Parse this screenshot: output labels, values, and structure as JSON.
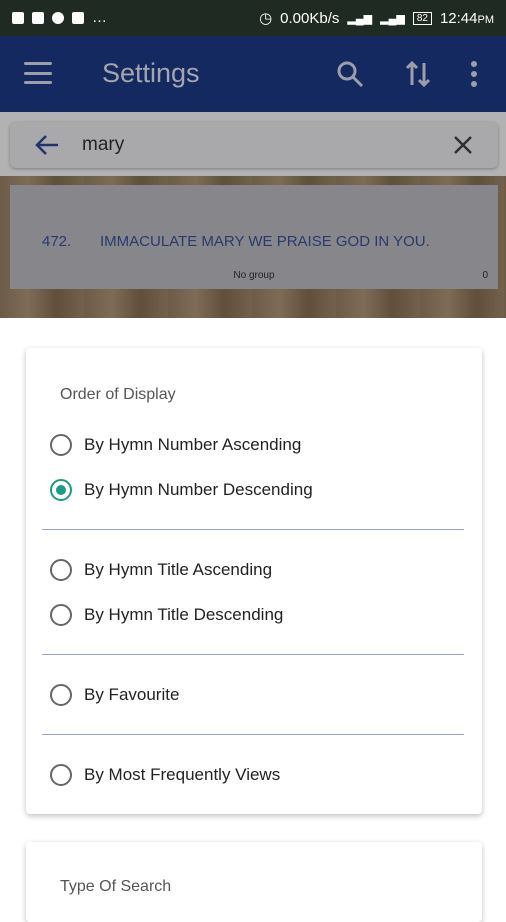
{
  "status_bar": {
    "speed": "0.00Kb/s",
    "time": "12:44",
    "ampm": "PM",
    "battery": "82"
  },
  "app_bar": {
    "title": "Settings"
  },
  "search": {
    "query": "mary"
  },
  "result": {
    "number": "472.",
    "title": "IMMACULATE MARY WE PRAISE GOD IN YOU.",
    "group": "No group",
    "count": "0"
  },
  "order_card": {
    "heading": "Order of Display",
    "options": [
      {
        "label": "By Hymn Number Ascending",
        "selected": false
      },
      {
        "label": "By Hymn Number Descending",
        "selected": true
      },
      {
        "label": "By Hymn Title Ascending",
        "selected": false
      },
      {
        "label": "By Hymn Title Descending",
        "selected": false
      },
      {
        "label": "By Favourite",
        "selected": false
      },
      {
        "label": "By Most Frequently Views",
        "selected": false
      }
    ]
  },
  "search_card": {
    "heading": "Type Of Search"
  },
  "colors": {
    "app_bar": "#1e3b8a",
    "accent": "#1e9a86",
    "result_text": "#3b53a0"
  }
}
